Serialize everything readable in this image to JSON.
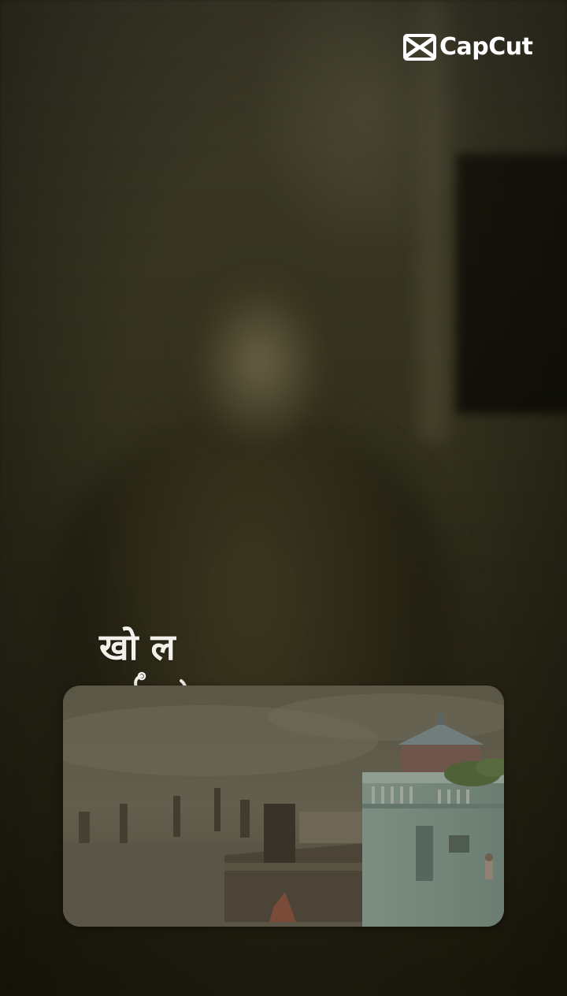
{
  "app": {
    "brand_name": "CapCut",
    "brand_color": "#ffffff"
  },
  "background": {
    "tone": "#2b2819"
  },
  "caption": {
    "text": "खो ल"
  },
  "icons": {
    "logo": "capcut-logo-icon",
    "flourish": "calligraphy-flourish-icon"
  }
}
